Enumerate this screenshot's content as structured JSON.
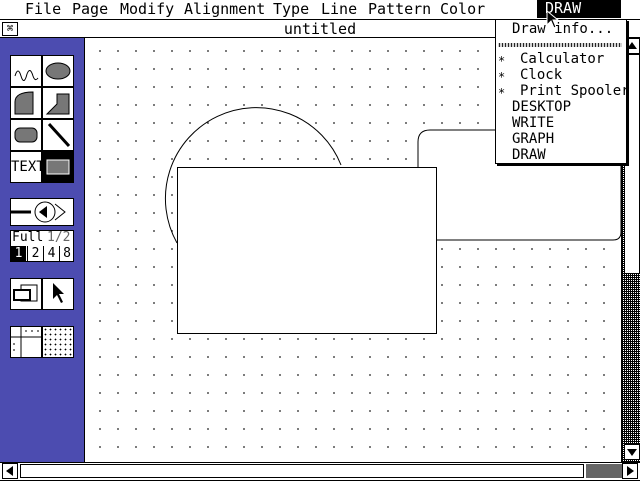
{
  "menubar": {
    "items": [
      "File",
      "Page",
      "Modify",
      "Alignment",
      "Type",
      "Line",
      "Pattern",
      "Color"
    ],
    "active_menu": "DRAW"
  },
  "window": {
    "title": "untitled",
    "close_glyph": "⌘"
  },
  "draw_menu": {
    "info": "Draw info...",
    "accessories": [
      {
        "label": "Calculator",
        "mark": "*"
      },
      {
        "label": "Clock",
        "mark": "*"
      },
      {
        "label": "Print Spooler",
        "mark": "*"
      }
    ],
    "apps": [
      "DESKTOP",
      "WRITE",
      "GRAPH",
      "DRAW"
    ]
  },
  "toolbox": {
    "text_tool_label": "TEXT",
    "zoom_labels": [
      "Full",
      "1/2"
    ],
    "zoom_numbers": [
      "1",
      "2",
      "4",
      "8"
    ],
    "selected_zoom": "1"
  },
  "colors": {
    "toolbox_bg": "#4c4cb0",
    "canvas_bg": "#ffffff",
    "ink": "#000000"
  }
}
